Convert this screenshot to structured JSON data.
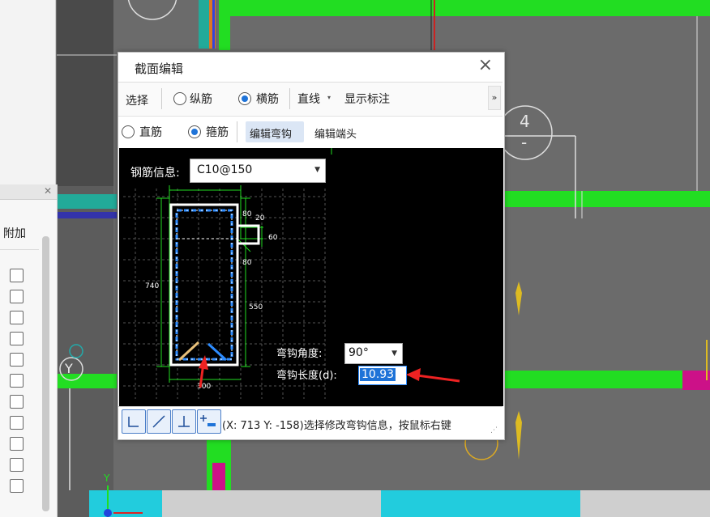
{
  "dialog": {
    "title": "截面编辑",
    "close_icon": "×",
    "toolbar1": {
      "select_label": "选择",
      "radio_longitudinal": "纵筋",
      "radio_transverse": "横筋",
      "line_combo": "直线",
      "show_label": "显示标注",
      "more_icon": "»"
    },
    "toolbar2": {
      "radio_straight": "直筋",
      "radio_stirrup": "箍筋",
      "edit_hook": "编辑弯钩",
      "edit_end": "编辑端头"
    },
    "canvas": {
      "rebar_info_label": "钢筋信息:",
      "rebar_info_value": "C10@150",
      "hook_angle_label": "弯钩角度:",
      "hook_angle_value": "90°",
      "hook_length_label": "弯钩长度(d):",
      "hook_length_value": "10.93",
      "dims": {
        "height": "740",
        "width": "300",
        "d550": "550",
        "d80a": "80",
        "d80b": "80",
        "d20": "20",
        "d60": "60"
      }
    },
    "status": {
      "text": "(X: 713 Y: -158)选择修改弯钩信息，按鼠标右键"
    }
  },
  "left_panel": {
    "column_header": "附加"
  },
  "drawing": {
    "circle_label_top": "4",
    "circle_label_bottom": "-",
    "axis_label_y": "Y"
  },
  "colors": {
    "accent": "#1e73d8",
    "cad_green": "#22dd22",
    "cad_bg": "#6b6b6b",
    "magenta": "#cc1188"
  }
}
